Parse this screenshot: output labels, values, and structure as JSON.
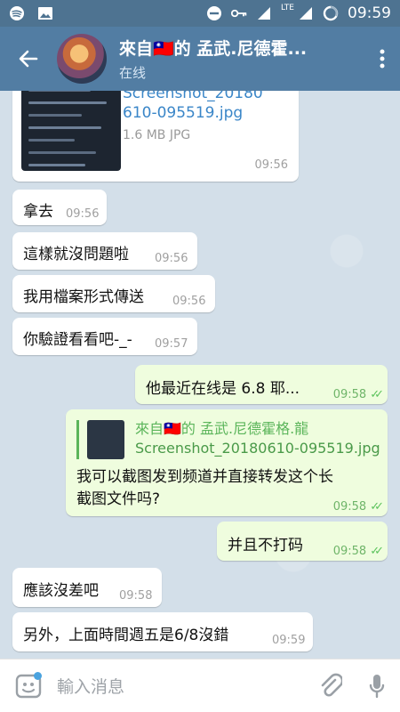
{
  "status_bar": {
    "time": "09:59",
    "network": "LTE"
  },
  "header": {
    "title": "來自🇹🇼的 孟武.尼德霍...",
    "subtitle": "在线"
  },
  "messages": {
    "file": {
      "name_line1": "Screenshot_20180",
      "name_line2": "610-095519.jpg",
      "size": "1.6 MB JPG",
      "time": "09:56"
    },
    "m1": {
      "text": "拿去",
      "time": "09:56"
    },
    "m2": {
      "text": "這樣就沒問題啦",
      "time": "09:56"
    },
    "m3": {
      "text": "我用檔案形式傳送",
      "time": "09:56"
    },
    "m4": {
      "text": "你驗證看看吧-_-",
      "time": "09:57"
    },
    "o1": {
      "text": "他最近在线是 6.8 耶...",
      "time": "09:58"
    },
    "o2": {
      "reply_name": "來自🇹🇼的 孟武.尼德霍格.龍",
      "reply_text": "Screenshot_20180610-095519.jpg",
      "text_line1": "我可以截图发到频道并直接转发这个长",
      "text_line2": "截图文件吗?",
      "time": "09:58"
    },
    "o3": {
      "text": "并且不打码",
      "time": "09:58"
    },
    "m5": {
      "text": "應該沒差吧",
      "time": "09:58"
    },
    "m6": {
      "text": "另外，上面時間週五是6/8沒錯",
      "time": "09:59"
    }
  },
  "input": {
    "placeholder": "輸入消息"
  },
  "colors": {
    "header": "#527da3",
    "status": "#4e7391",
    "incoming": "#ffffff",
    "outgoing": "#effdde",
    "accent": "#5bb55a"
  }
}
